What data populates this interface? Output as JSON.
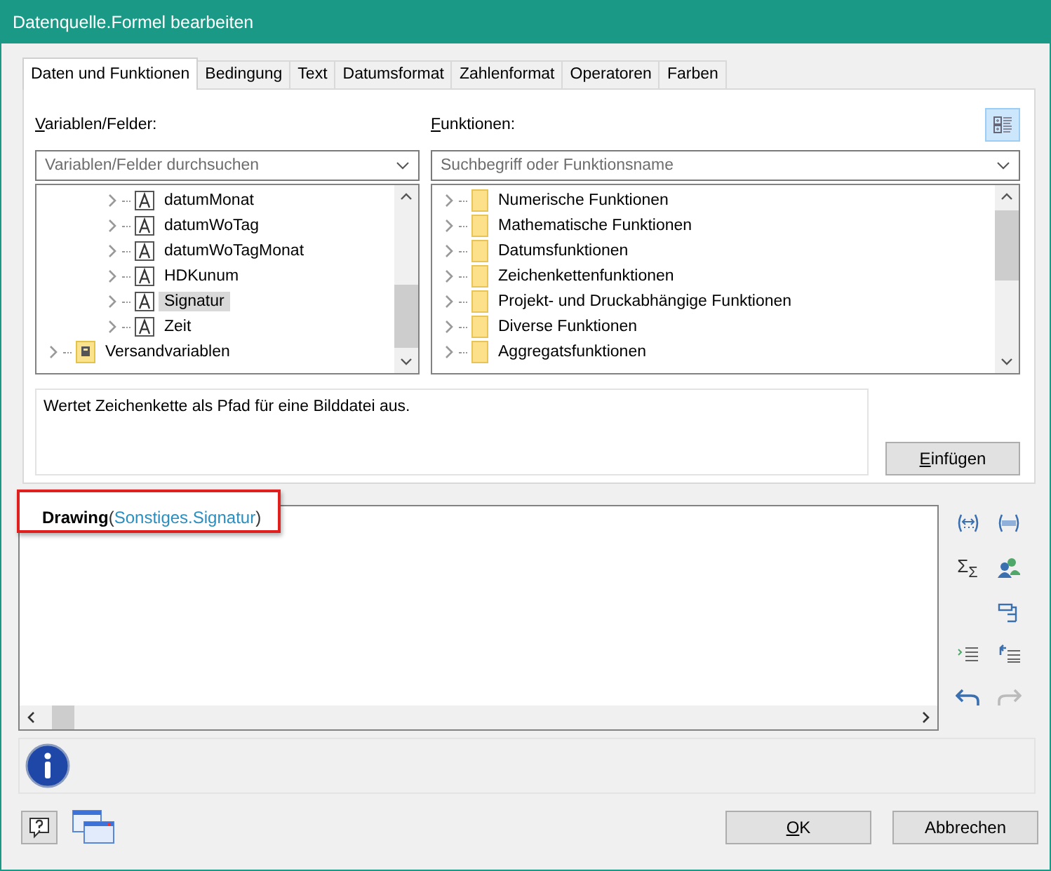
{
  "window": {
    "title": "Datenquelle.Formel bearbeiten"
  },
  "tabs": [
    {
      "label": "Daten und Funktionen",
      "selected": true
    },
    {
      "label": "Bedingung",
      "selected": false
    },
    {
      "label": "Text",
      "selected": false
    },
    {
      "label": "Datumsformat",
      "selected": false
    },
    {
      "label": "Zahlenformat",
      "selected": false
    },
    {
      "label": "Operatoren",
      "selected": false
    },
    {
      "label": "Farben",
      "selected": false
    }
  ],
  "variables": {
    "label": "Variablen/Felder:",
    "search": {
      "placeholder": "Variablen/Felder durchsuchen"
    },
    "items": [
      {
        "children": [
          {
            "label": "datumMonat",
            "kind": "text",
            "selected": false
          },
          {
            "label": "datumWoTag",
            "kind": "text",
            "selected": false
          },
          {
            "label": "datumWoTagMonat",
            "kind": "text",
            "selected": false
          },
          {
            "label": "HDKunum",
            "kind": "text",
            "selected": false
          },
          {
            "label": "Signatur",
            "kind": "text",
            "selected": true
          },
          {
            "label": "Zeit",
            "kind": "text",
            "selected": false
          }
        ]
      },
      {
        "label": "Versandvariablen",
        "kind": "group",
        "selected": false
      }
    ]
  },
  "functions": {
    "label": "Funktionen:",
    "search": {
      "placeholder": "Suchbegriff oder Funktionsname"
    },
    "items": [
      {
        "label": "Numerische Funktionen",
        "kind": "folder",
        "selected": false
      },
      {
        "label": "Mathematische Funktionen",
        "kind": "folder",
        "selected": false
      },
      {
        "label": "Datumsfunktionen",
        "kind": "folder",
        "selected": false
      },
      {
        "label": "Zeichenkettenfunktionen",
        "kind": "folder",
        "selected": false
      },
      {
        "label": "Projekt- und Druckabhängige Funktionen",
        "kind": "folder",
        "selected": false
      },
      {
        "label": "Diverse Funktionen",
        "kind": "folder",
        "selected": false
      },
      {
        "label": "Aggregatsfunktionen",
        "kind": "folder",
        "selected": false
      }
    ]
  },
  "description": "Wertet Zeichenkette als Pfad für eine Bilddatei aus.",
  "insert_button": "Einfügen",
  "editor": {
    "tokens": [
      {
        "text": "Drawing",
        "kind": "function"
      },
      {
        "text": "(",
        "kind": "punct"
      },
      {
        "text": "Sonstiges.Signatur",
        "kind": "field"
      },
      {
        "text": ")",
        "kind": "punct"
      }
    ]
  },
  "sum_symbol": "Σ$_{Σ}$",
  "buttons": [
    {
      "label": "OK",
      "kind": "ok"
    },
    {
      "label": "Abbrechen",
      "kind": "cancel"
    }
  ]
}
